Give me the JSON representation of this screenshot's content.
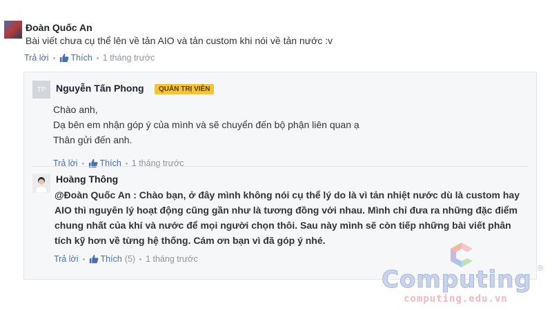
{
  "comments": {
    "top": {
      "author": "Đoàn Quốc An",
      "text": "Bài viết chưa cụ thể lên về tản AIO và tản custom khi nói về tản nước :v",
      "reply_label": "Trả lời",
      "like_label": "Thích",
      "time": "1 tháng trước"
    },
    "replies": [
      {
        "avatar_initials": "TP",
        "author": "Nguyễn Tấn Phong",
        "badge": "QUẢN TRỊ VIÊN",
        "lines": [
          "Chào anh,",
          "Dạ bên em nhận góp ý của mình và sẽ chuyển đến bộ phận liên quan ạ",
          "Thân gửi đến anh."
        ],
        "reply_label": "Trả lời",
        "like_label": "Thích",
        "time": "1 tháng trước"
      },
      {
        "author": "Hoàng Thông",
        "text": "@Đoàn Quốc An : Chào bạn, ở đây mình không nói cụ thể lý do là vì tản nhiệt nước dù là custom hay AIO thì nguyên lý hoạt động cũng gần như là tương đồng với nhau. Mình chỉ đưa ra những đặc điểm chung nhất của khí và nước để mọi người chọn thôi. Sau này mình sẽ còn tiếp những bài viết phân tích kỹ hơn về từng hệ thống. Cám ơn bạn vì đã góp ý nhé.",
        "reply_label": "Trả lời",
        "like_label": "Thích",
        "like_count": "(5)",
        "time": "1 tháng trước"
      }
    ]
  },
  "watermark": {
    "brand": "Computing",
    "registered": "®",
    "url": "computing.edu.vn"
  },
  "colors": {
    "link": "#4b6eb1",
    "badge_bg": "#f5c33b",
    "panel_bg": "#f6f7f9"
  },
  "icons": {
    "like": "thumbs-up-icon"
  }
}
